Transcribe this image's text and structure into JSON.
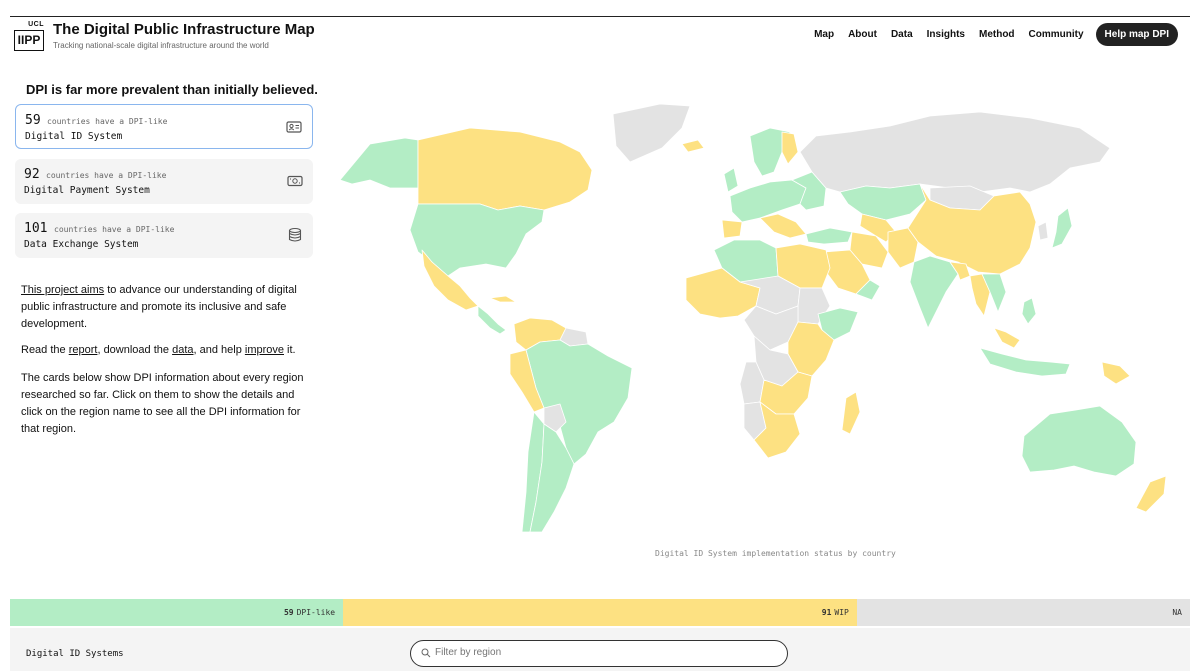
{
  "header": {
    "logo_top": "UCL",
    "logo_box": "IIPP",
    "title": "The Digital Public Infrastructure Map",
    "subtitle": "Tracking national-scale digital infrastructure around the world",
    "nav": [
      "Map",
      "About",
      "Data",
      "Insights",
      "Method",
      "Community"
    ],
    "cta": "Help map DPI"
  },
  "headline": "DPI is far more prevalent than initially believed.",
  "cards": [
    {
      "count": "59",
      "prefix": "countries have a DPI-like",
      "name": "Digital ID System",
      "icon": "id-card-icon"
    },
    {
      "count": "92",
      "prefix": "countries have a DPI-like",
      "name": "Digital Payment System",
      "icon": "payment-icon"
    },
    {
      "count": "101",
      "prefix": "countries have a DPI-like",
      "name": "Data Exchange System",
      "icon": "database-icon"
    }
  ],
  "intro": {
    "link1": "This project aims",
    "text1": " to advance our understanding of digital public infrastructure and promote its inclusive and safe development.",
    "read_pre": "Read the ",
    "report": "report",
    "read_mid1": ", download the ",
    "data": "data",
    "read_mid2": ", and help ",
    "improve": "improve",
    "read_end": " it.",
    "cards_text": "The cards below show DPI information about every region researched so far. Click on them to show the details and click on the region name to see all the DPI information for that region."
  },
  "map": {
    "caption": "Digital ID System implementation status by country",
    "colors": {
      "dpi_like": "#b3edc5",
      "wip": "#fde182",
      "na": "#e3e3e3"
    }
  },
  "status": [
    {
      "count": "59",
      "label": "DPI-like",
      "share": 59,
      "color": "#b3edc5"
    },
    {
      "count": "91",
      "label": "WIP",
      "share": 91,
      "color": "#fde182"
    },
    {
      "count": "",
      "label": "NA",
      "share": 59,
      "color": "#e3e3e3"
    }
  ],
  "bottom": {
    "title": "Digital ID Systems",
    "filter_placeholder": "Filter by region"
  }
}
